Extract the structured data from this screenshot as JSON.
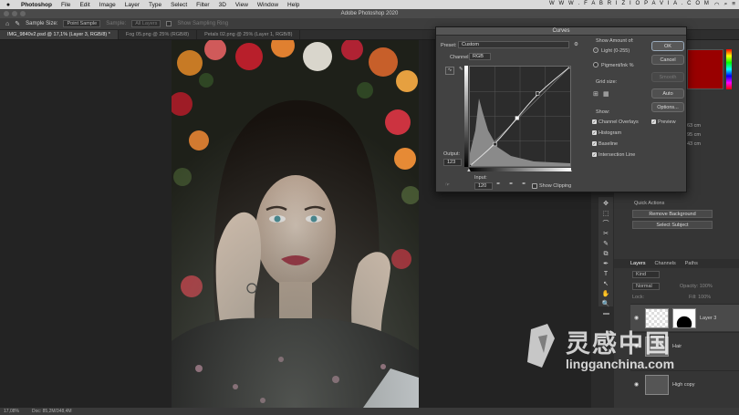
{
  "menubar": {
    "apple": "",
    "items": [
      "Photoshop",
      "File",
      "Edit",
      "Image",
      "Layer",
      "Type",
      "Select",
      "Filter",
      "3D",
      "View",
      "Window",
      "Help"
    ],
    "site": "W W W . F A B R I Z I O P A V I A . C O M"
  },
  "window": {
    "title": "Adobe Photoshop 2020"
  },
  "options": {
    "sample_size_label": "Sample Size:",
    "sample_size": "Point Sample",
    "sample_label": "Sample:",
    "sample": "All Layers",
    "show_ring": "Show Sampling Ring"
  },
  "tabs": [
    "IMG_9840v2.psd @ 17,1% (Layer 3, RGB/8) *",
    "Fog 05.png @ 25% (RGB/8)",
    "Petals 02.png @ 25% (Layer 1, RGB/8)"
  ],
  "status": {
    "zoom": "17,08%",
    "doc": "Doc: 85,2M/348,4M"
  },
  "curves": {
    "title": "Curves",
    "preset_label": "Preset:",
    "preset": "Custom",
    "channel_label": "Channel:",
    "channel": "RGB",
    "output_label": "Output:",
    "output": "123",
    "input_label": "Input:",
    "input": "120",
    "show_clipping": "Show Clipping",
    "show_amount_label": "Show Amount of:",
    "light": "Light  (0-255)",
    "pigment": "Pigment/Ink %",
    "grid_size_label": "Grid size:",
    "show_label": "Show:",
    "show_items": [
      "Channel Overlays",
      "Histogram",
      "Baseline",
      "Intersection Line"
    ],
    "buttons": {
      "ok": "OK",
      "cancel": "Cancel",
      "smooth": "Smooth",
      "auto": "Auto",
      "options": "Options..."
    },
    "preview": "Preview",
    "curve_points": [
      [
        0,
        0
      ],
      [
        64,
        56
      ],
      [
        120,
        123
      ],
      [
        172,
        186
      ],
      [
        255,
        255
      ]
    ]
  },
  "right_panel": {
    "quick_actions": "Quick Actions",
    "remove_bg": "Remove Background",
    "select_subject": "Select Subject",
    "layers_tabs": [
      "Layers",
      "Channels",
      "Paths"
    ],
    "kind": "Kind",
    "normal": "Normal",
    "opacity": "Opacity: 100%",
    "lock": "Lock:",
    "fill": "Fill: 100%",
    "layers": [
      "Layer 3",
      "Hair",
      "High copy"
    ],
    "props": [
      "63 cm",
      "95 cm",
      "43 cm"
    ]
  },
  "tools": [
    "✥",
    "⬚",
    "⌒",
    "✂",
    "✎",
    "⧉",
    "✒",
    "T",
    "↖",
    "✋",
    "🔍"
  ],
  "watermark": {
    "cn": "灵感中国",
    "en": "lingganchina.com"
  }
}
